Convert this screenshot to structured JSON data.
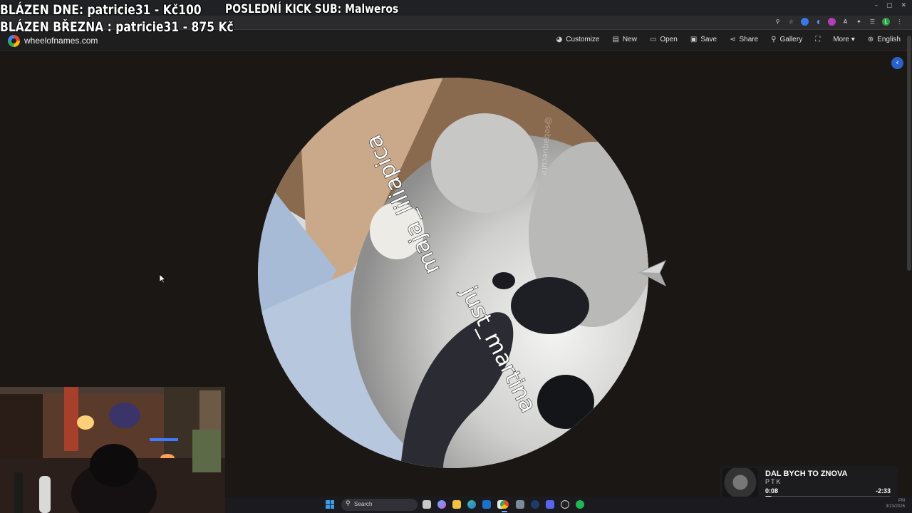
{
  "overlay": {
    "line1": "BLÁZEN DNE: patricie31 - Kč100",
    "line2": "BLÁZEN BŘEZNA : patricie31 - 875 Kč",
    "kick_sub": "POSLEDNÍ KICK SUB: Malweros"
  },
  "browser": {
    "window_controls": [
      "–",
      "▢",
      "✕"
    ],
    "extension_icons": [
      "zoom-icon",
      "star-icon",
      "extension-1",
      "extension-2",
      "extension-3",
      "extension-4",
      "puzzle-icon",
      "tab-search-icon",
      "profile-avatar"
    ]
  },
  "site": {
    "name": "wheelofnames.com",
    "nav": [
      {
        "icon": "palette-icon",
        "label": "Customize"
      },
      {
        "icon": "file-icon",
        "label": "New"
      },
      {
        "icon": "folder-icon",
        "label": "Open"
      },
      {
        "icon": "floppy-icon",
        "label": "Save"
      },
      {
        "icon": "share-icon",
        "label": "Share"
      },
      {
        "icon": "search-icon",
        "label": "Gallery"
      },
      {
        "icon": "fullscreen-icon",
        "label": ""
      },
      {
        "icon": "",
        "label": "More ▾"
      },
      {
        "icon": "globe-icon",
        "label": "English"
      }
    ]
  },
  "wheel": {
    "entries": [
      "maja_liliapica",
      "just_martina"
    ],
    "watermark": "@sobaquecute"
  },
  "music": {
    "song": "DAL BYCH TO ZNOVA",
    "artist": "PTK",
    "elapsed": "0:08",
    "remaining": "-2:33",
    "progress": 0.05
  },
  "taskbar": {
    "search_placeholder": "Search",
    "clock": "PM\n3/23/2026"
  },
  "colors": {
    "accent_blue": "#2962c9",
    "background": "#1b1715"
  }
}
